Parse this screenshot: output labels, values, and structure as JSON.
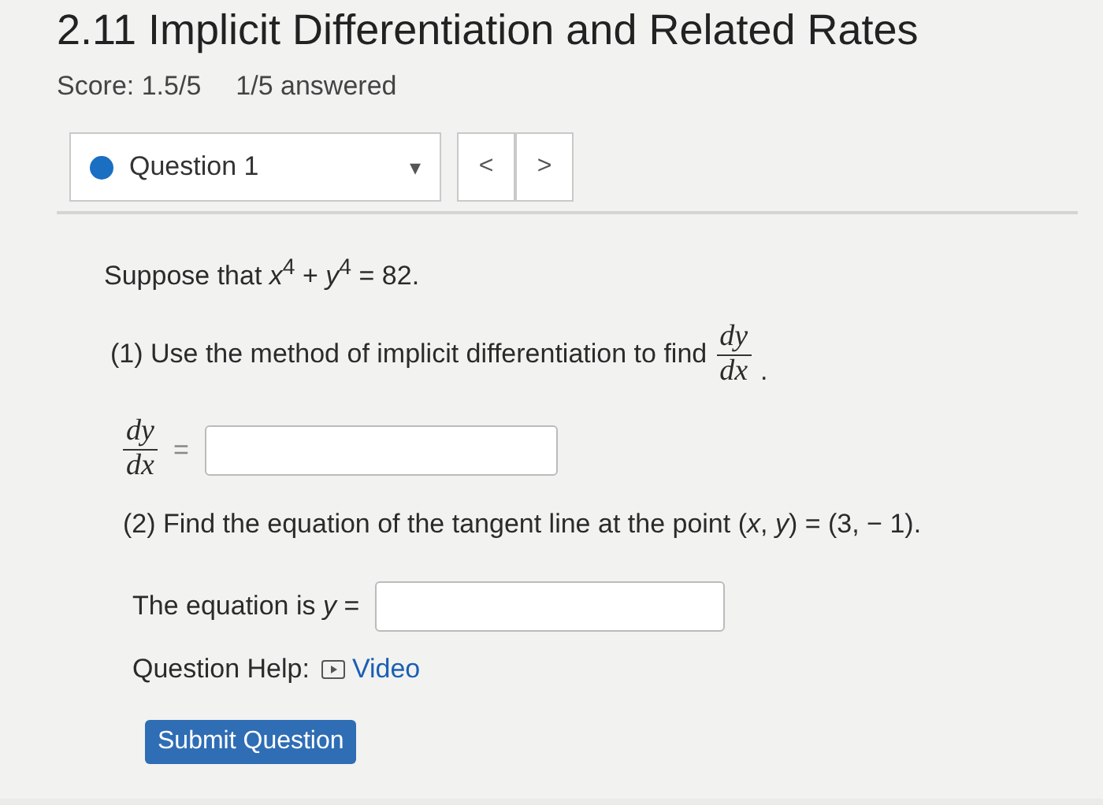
{
  "title": "2.11 Implicit Differentiation and Related Rates",
  "score": "Score: 1.5/5",
  "answered": "1/5 answered",
  "question_select": {
    "label": "Question 1",
    "caret": "▾"
  },
  "nav": {
    "prev": "<",
    "next": ">"
  },
  "statement": "Suppose that *x*$^{4}$ + *y*$^{4}$ = 82.",
  "part1": {
    "text": "(1) Use the method of implicit differentiation to find",
    "numerator": "dy",
    "denominator": "dx",
    "after": "."
  },
  "answer1": {
    "numerator": "dy",
    "denominator": "dx",
    "equals": "="
  },
  "part2": "(2) Find the equation of the tangent line at the point (*x*, *y*) = (3, − 1).",
  "answer2_label": "The equation is *y* =",
  "help_label": "Question Help:",
  "video": "Video",
  "submit": "Submit Question"
}
